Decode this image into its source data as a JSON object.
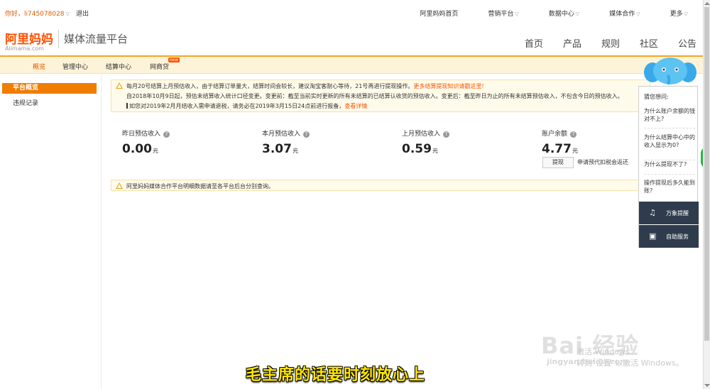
{
  "topbar": {
    "greeting": "你好，li745078028",
    "logout": "退出",
    "links": [
      "阿里妈妈首页",
      "营销平台",
      "数据中心",
      "媒体合作",
      "更多"
    ]
  },
  "header": {
    "logo_cn": "阿里妈妈",
    "logo_en": "Alimama.com",
    "platform": "媒体流量平台",
    "nav": [
      "首页",
      "产品",
      "规则",
      "社区",
      "公告"
    ]
  },
  "subnav": {
    "items": [
      "概览",
      "管理中心",
      "结算中心",
      "网商贷"
    ],
    "new_badge": "new",
    "active_color": "#e05b00"
  },
  "sidebar": {
    "active": "平台概览",
    "items": [
      "违规记录"
    ]
  },
  "notice": {
    "line1": "每月20号结算上月预估收入，由于结算订单量大，结算时间会较长，建议淘宝客耐心等待，21号再进行提现操作。",
    "line1_link": "更多结算提现知识请戳这里!",
    "line2": "自2018年10月9日起，预估未结算收入统计口径变更。变更前：截至当前实时更新的所有未结算的已结算认收货的预估收入。变更后：截至昨日为止的所有未结算预估收入，不包含今日的预估收入。",
    "line3": "如您对2019年2月月结收入需申请退税，请务必在2019年3月15日24点前进行报备，",
    "line3_link": "查看详情"
  },
  "stats": [
    {
      "label": "昨日预估收入",
      "value": "0.00",
      "unit": "元"
    },
    {
      "label": "本月预估收入",
      "value": "3.07",
      "unit": "元"
    },
    {
      "label": "上月预估收入",
      "value": "0.59",
      "unit": "元"
    },
    {
      "label": "账户余额",
      "value": "4.77",
      "unit": "元"
    }
  ],
  "withdraw": {
    "button": "提现",
    "note": "申请预代扣税会返还"
  },
  "notice2": "阿里妈妈媒体合作平台明细数据请至各平台后台分别查询。",
  "help": {
    "title": "猜您想问:",
    "questions": [
      "为什么账户余额的钱对不上?",
      "为什么结算中心中的收入显示为0?",
      "为什么提现不了?",
      "操作提现后多久能到账?"
    ],
    "reminder": "万象提醒",
    "self_service": "自助服务"
  },
  "green_tab": "56",
  "watermark": {
    "activate_line1": "激活 Windows",
    "activate_line2": "转到\"设置\"以激活 Windows。",
    "baidu": "Bai 经验",
    "jingyan": "jingyan.baidu.com"
  },
  "subtitle": "毛主席的话要时刻放心上"
}
